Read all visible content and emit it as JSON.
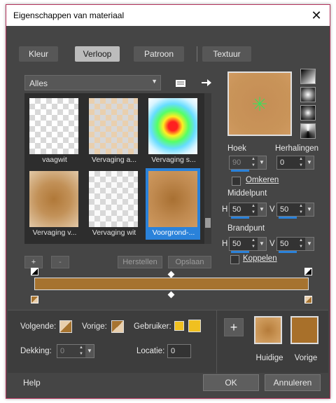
{
  "window": {
    "title": "Eigenschappen van materiaal",
    "close_glyph": "✕"
  },
  "tabs": [
    {
      "label": "Kleur",
      "active": false
    },
    {
      "label": "Verloop",
      "active": true
    },
    {
      "label": "Patroon",
      "active": false
    },
    {
      "label": "Textuur",
      "active": false
    }
  ],
  "category": {
    "selected": "Alles"
  },
  "gradients": [
    {
      "label": "vaagwit",
      "selected": false
    },
    {
      "label": "Vervaging a...",
      "selected": false
    },
    {
      "label": "Vervaging s...",
      "selected": false
    },
    {
      "label": "Vervaging v...",
      "selected": false
    },
    {
      "label": "Vervaging wit",
      "selected": false
    },
    {
      "label": "Voorgrond-...",
      "selected": true
    }
  ],
  "list_buttons": {
    "add": "+",
    "remove": "-",
    "restore": "Herstellen",
    "save": "Opslaan"
  },
  "style": {
    "angle_label": "Hoek",
    "angle_value": "90",
    "repeats_label": "Herhalingen",
    "repeats_value": "0",
    "invert_label": "Omkeren",
    "center_label": "Middelpunt",
    "center_h_label": "H",
    "center_h": "50",
    "center_v_label": "V",
    "center_v": "50",
    "focal_label": "Brandpunt",
    "focal_h_label": "H",
    "focal_h": "50",
    "focal_v_label": "V",
    "focal_v": "50",
    "link_label": "Koppelen"
  },
  "stops": {
    "next_label": "Volgende:",
    "prev_label": "Vorige:",
    "user_label": "Gebruiker:",
    "opacity_label": "Dekking:",
    "opacity_value": "0",
    "location_label": "Locatie:",
    "location_value": "0"
  },
  "current": {
    "add": "+",
    "current_label": "Huidige",
    "previous_label": "Vorige"
  },
  "footer": {
    "help": "Help",
    "ok": "OK",
    "cancel": "Annuleren"
  },
  "colors": {
    "accent": "#2a82da",
    "gradient_brown": "#a6732f",
    "gradient_light": "#c9965c",
    "user_yellow": "#f0c020"
  }
}
